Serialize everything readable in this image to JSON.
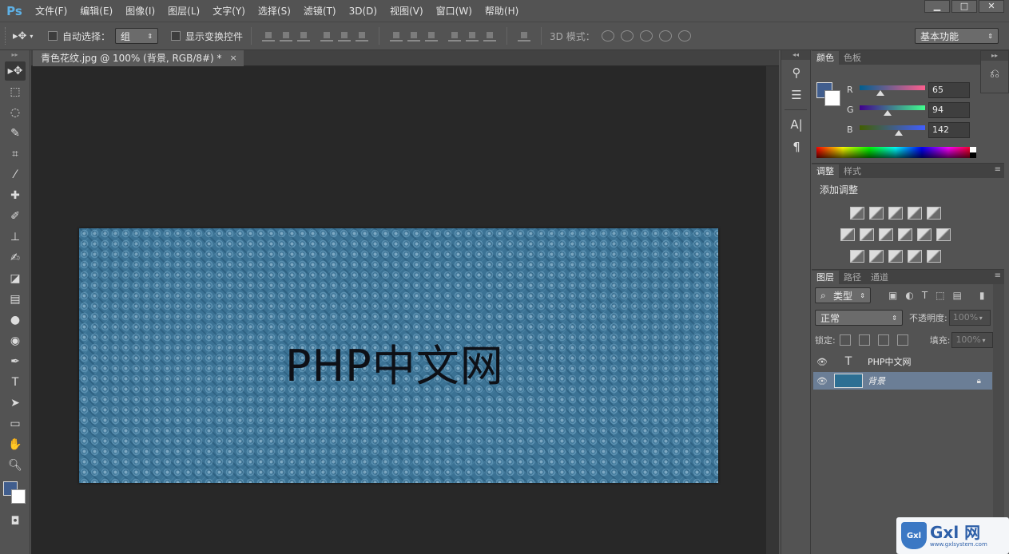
{
  "app": {
    "logo": "Ps",
    "menus": [
      "文件(F)",
      "编辑(E)",
      "图像(I)",
      "图层(L)",
      "文字(Y)",
      "选择(S)",
      "滤镜(T)",
      "3D(D)",
      "视图(V)",
      "窗口(W)",
      "帮助(H)"
    ],
    "window_controls": {
      "minimize": "▁",
      "restore": "□",
      "close": "✕"
    }
  },
  "options": {
    "auto_select_label": "自动选择：",
    "auto_select_value": "组",
    "transform_controls_label": "显示变换控件",
    "mode3d_label": "3D 模式：",
    "workspace": "基本功能"
  },
  "document": {
    "tab_title": "青色花纹.jpg @ 100% (背景, RGB/8#) *",
    "close": "×",
    "canvas_text": "PHP中文网",
    "canvas_color": "#3b7294"
  },
  "panels": {
    "color": {
      "tabs": [
        "颜色",
        "色板"
      ],
      "r_label": "R",
      "r_value": "65",
      "g_label": "G",
      "g_value": "94",
      "b_label": "B",
      "b_value": "142",
      "fg_color": "#415e8e",
      "bg_color": "#ffffff"
    },
    "adjustments": {
      "tabs": [
        "调整",
        "样式"
      ],
      "title": "添加调整"
    },
    "layers": {
      "tabs": [
        "图层",
        "路径",
        "通道"
      ],
      "filter_type": "类型",
      "blend_mode": "正常",
      "opacity_label": "不透明度:",
      "opacity_value": "100%",
      "lock_label": "锁定:",
      "fill_label": "填充:",
      "fill_value": "100%",
      "items": [
        {
          "name": "PHP中文网",
          "kind": "text"
        },
        {
          "name": "背景",
          "kind": "image",
          "locked": true
        }
      ]
    }
  },
  "watermark": {
    "text": "Gxl 网",
    "url": "www.gxlsystem.com",
    "badge": "Gxl"
  }
}
